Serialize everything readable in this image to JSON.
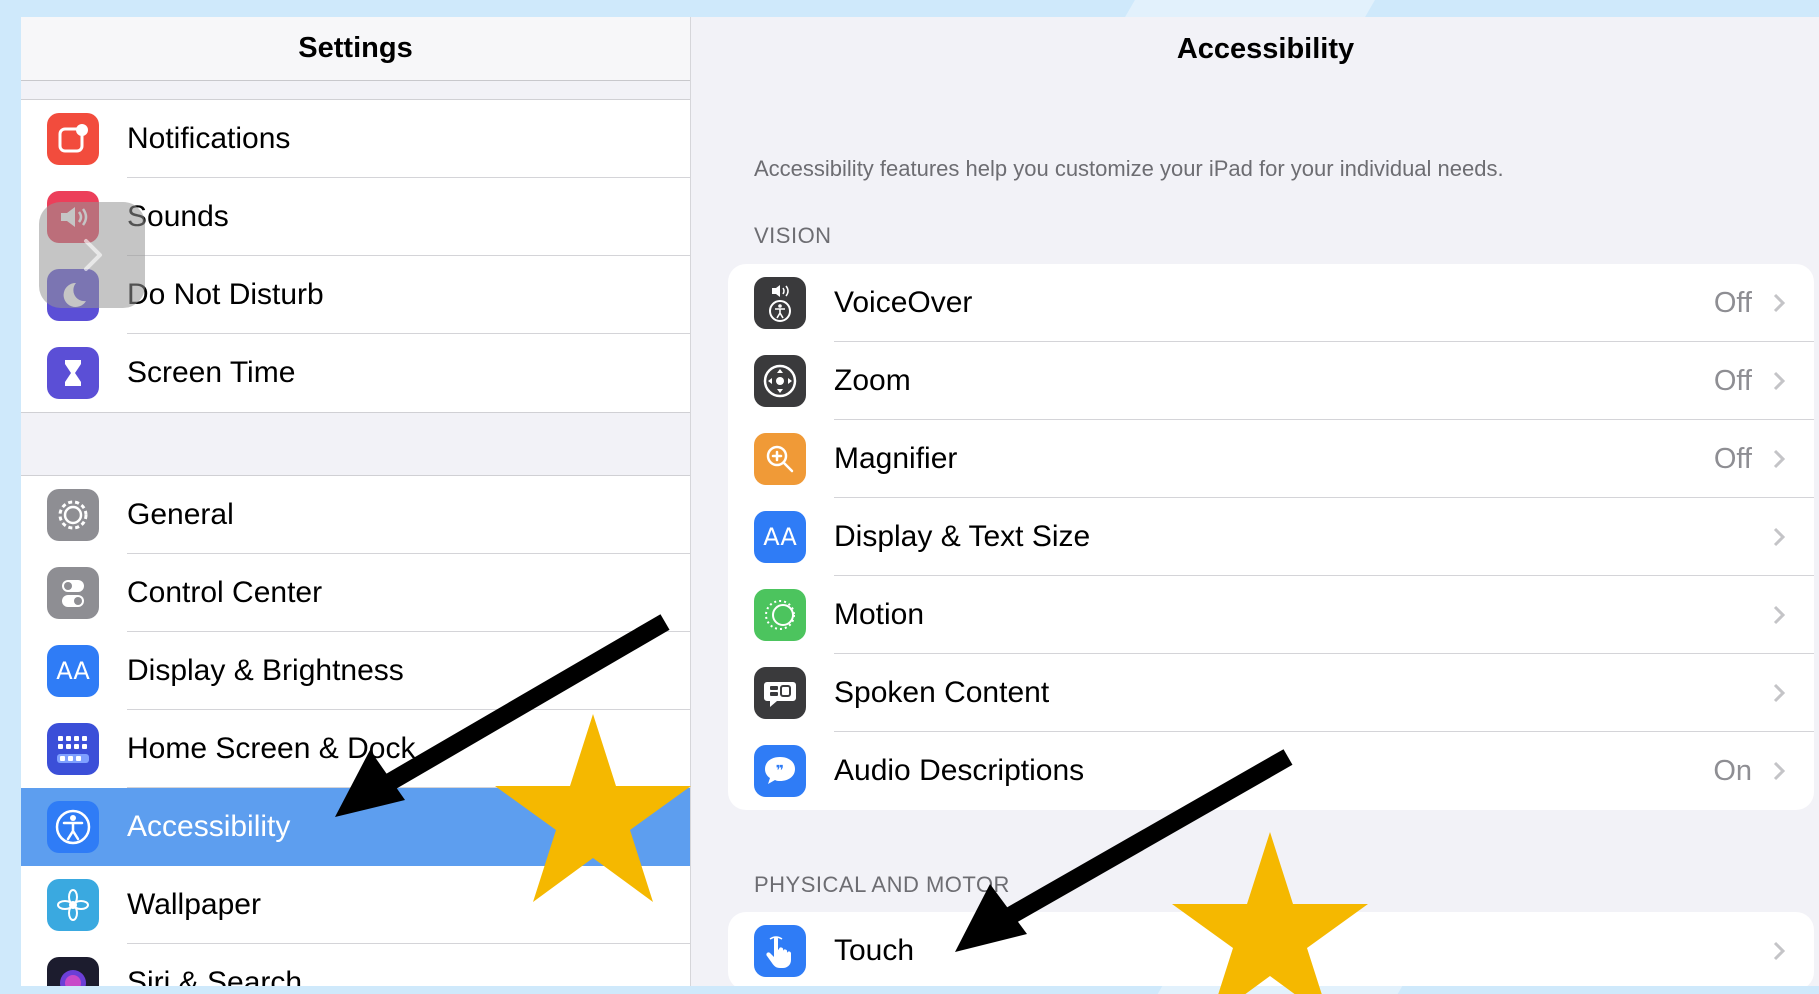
{
  "sidebar": {
    "title": "Settings",
    "group1": [
      {
        "label": "Notifications",
        "icon": "notifications-icon",
        "color": "#f24c3d"
      },
      {
        "label": "Sounds",
        "icon": "speaker-icon",
        "color": "#ec3f5a"
      },
      {
        "label": "Do Not Disturb",
        "icon": "moon-icon",
        "color": "#5b4fd6"
      },
      {
        "label": "Screen Time",
        "icon": "hourglass-icon",
        "color": "#5b4fd6"
      }
    ],
    "group2": [
      {
        "label": "General",
        "icon": "gear-icon",
        "color": "#8e8e93"
      },
      {
        "label": "Control Center",
        "icon": "toggles-icon",
        "color": "#8e8e93"
      },
      {
        "label": "Display & Brightness",
        "icon": "text-size-icon",
        "color": "#2f7cf6"
      },
      {
        "label": "Home Screen & Dock",
        "icon": "home-grid-icon",
        "color": "#3b4fd8"
      },
      {
        "label": "Accessibility",
        "icon": "accessibility-icon",
        "color": "#2f7cf6",
        "selected": true
      },
      {
        "label": "Wallpaper",
        "icon": "flower-icon",
        "color": "#3aa9e0"
      },
      {
        "label": "Siri & Search",
        "icon": "siri-icon",
        "color": "#1c1c2e"
      }
    ]
  },
  "detail": {
    "title": "Accessibility",
    "description": "Accessibility features help you customize your iPad for your individual needs.",
    "vision_header": "VISION",
    "vision": [
      {
        "label": "VoiceOver",
        "value": "Off",
        "icon": "voiceover-icon",
        "color": "#3a3a3c"
      },
      {
        "label": "Zoom",
        "value": "Off",
        "icon": "zoom-icon",
        "color": "#3a3a3c"
      },
      {
        "label": "Magnifier",
        "value": "Off",
        "icon": "magnifier-icon",
        "color": "#f09a37"
      },
      {
        "label": "Display & Text Size",
        "value": "",
        "icon": "text-size-icon",
        "color": "#2f7cf6"
      },
      {
        "label": "Motion",
        "value": "",
        "icon": "motion-icon",
        "color": "#4cc45e"
      },
      {
        "label": "Spoken Content",
        "value": "",
        "icon": "speech-bubble-icon",
        "color": "#3a3a3c"
      },
      {
        "label": "Audio Descriptions",
        "value": "On",
        "icon": "quote-bubble-icon",
        "color": "#2f7cf6"
      }
    ],
    "physical_header": "PHYSICAL AND MOTOR",
    "physical": [
      {
        "label": "Touch",
        "value": "",
        "icon": "hand-touch-icon",
        "color": "#2f7cf6"
      }
    ]
  },
  "colors": {
    "background": "#cfe9fb",
    "selected_row": "#5d9eef",
    "annotation_star": "#f5b800",
    "annotation_arrow": "#000000"
  }
}
